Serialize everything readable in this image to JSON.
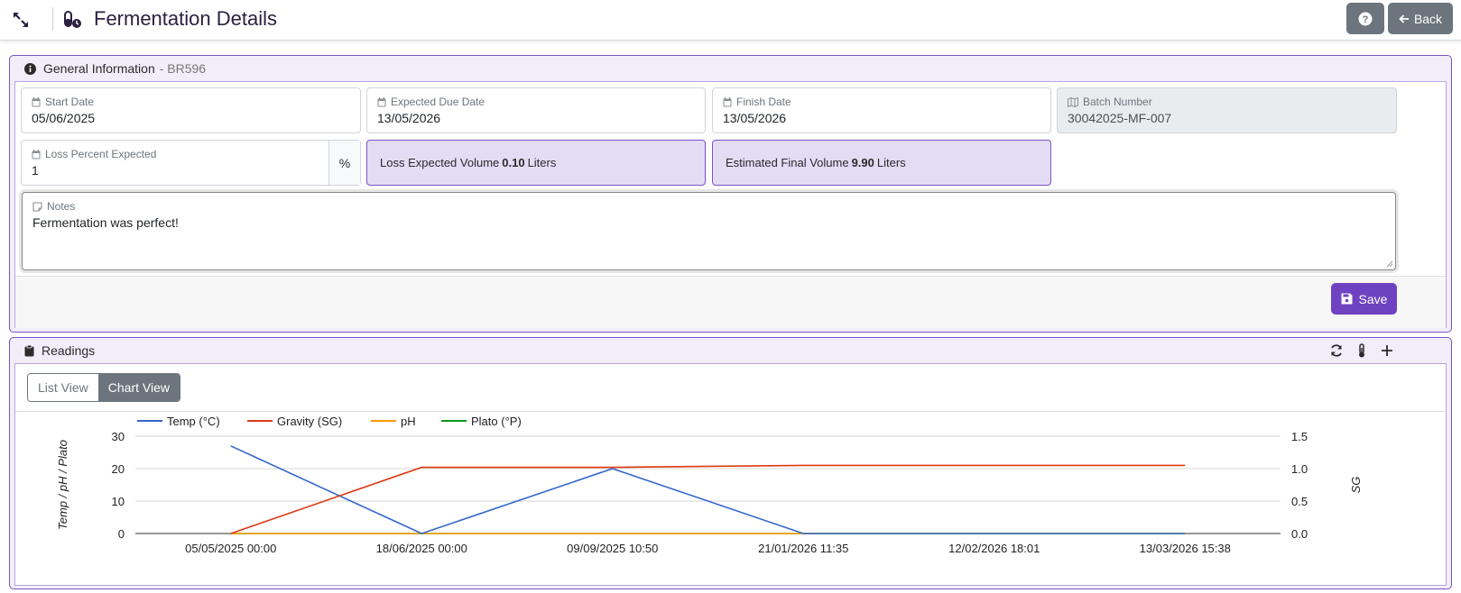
{
  "topbar": {
    "title": "Fermentation Details",
    "back_label": "Back"
  },
  "general": {
    "header": "General Information",
    "batch_ref": "- BR596",
    "start_date": {
      "label": "Start Date",
      "value": "05/06/2025"
    },
    "due_date": {
      "label": "Expected Due Date",
      "value": "13/05/2026"
    },
    "finish_date": {
      "label": "Finish Date",
      "value": "13/05/2026"
    },
    "batch_number": {
      "label": "Batch Number",
      "value": "30042025-MF-007"
    },
    "loss_percent": {
      "label": "Loss Percent Expected",
      "value": "1",
      "unit": "%"
    },
    "loss_volume": {
      "prefix": "Loss Expected Volume",
      "value": "0.10",
      "unit": "Liters"
    },
    "final_volume": {
      "prefix": "Estimated Final Volume",
      "value": "9.90",
      "unit": "Liters"
    },
    "notes": {
      "label": "Notes",
      "value": "Fermentation was perfect!"
    },
    "save_label": "Save"
  },
  "readings": {
    "header": "Readings",
    "list_view_label": "List View",
    "chart_view_label": "Chart View"
  },
  "colors": {
    "accent": "#6f42c1",
    "temp": "#3366cc",
    "gravity": "#dc3912",
    "ph": "#ff9900",
    "plato": "#109618"
  },
  "chart_data": {
    "type": "line",
    "categories": [
      "05/05/2025 00:00",
      "18/06/2025 00:00",
      "09/09/2025 10:50",
      "21/01/2026 11:35",
      "12/02/2026 18:01",
      "13/03/2026 15:38"
    ],
    "series": [
      {
        "name": "Temp (°C)",
        "axis": "left",
        "color": "#3366cc",
        "values": [
          27,
          0,
          20,
          0,
          0,
          0
        ]
      },
      {
        "name": "Gravity (SG)",
        "axis": "right",
        "color": "#dc3912",
        "values": [
          0,
          1.02,
          1.02,
          1.05,
          1.05,
          1.05
        ]
      },
      {
        "name": "pH",
        "axis": "left",
        "color": "#ff9900",
        "values": [
          0,
          0,
          0,
          0,
          0,
          0
        ]
      },
      {
        "name": "Plato (°P)",
        "axis": "left",
        "color": "#109618",
        "values": [
          0,
          0,
          0,
          0,
          0,
          0
        ]
      }
    ],
    "ylabel": "Temp / pH / Plato",
    "y2label": "SG",
    "ylim": [
      0,
      30
    ],
    "y2lim": [
      0,
      1.5
    ],
    "yticks": [
      "0",
      "10",
      "20",
      "30"
    ],
    "y2ticks": [
      "0.0",
      "0.5",
      "1.0",
      "1.5"
    ],
    "legend": "top-left",
    "grid": true
  }
}
